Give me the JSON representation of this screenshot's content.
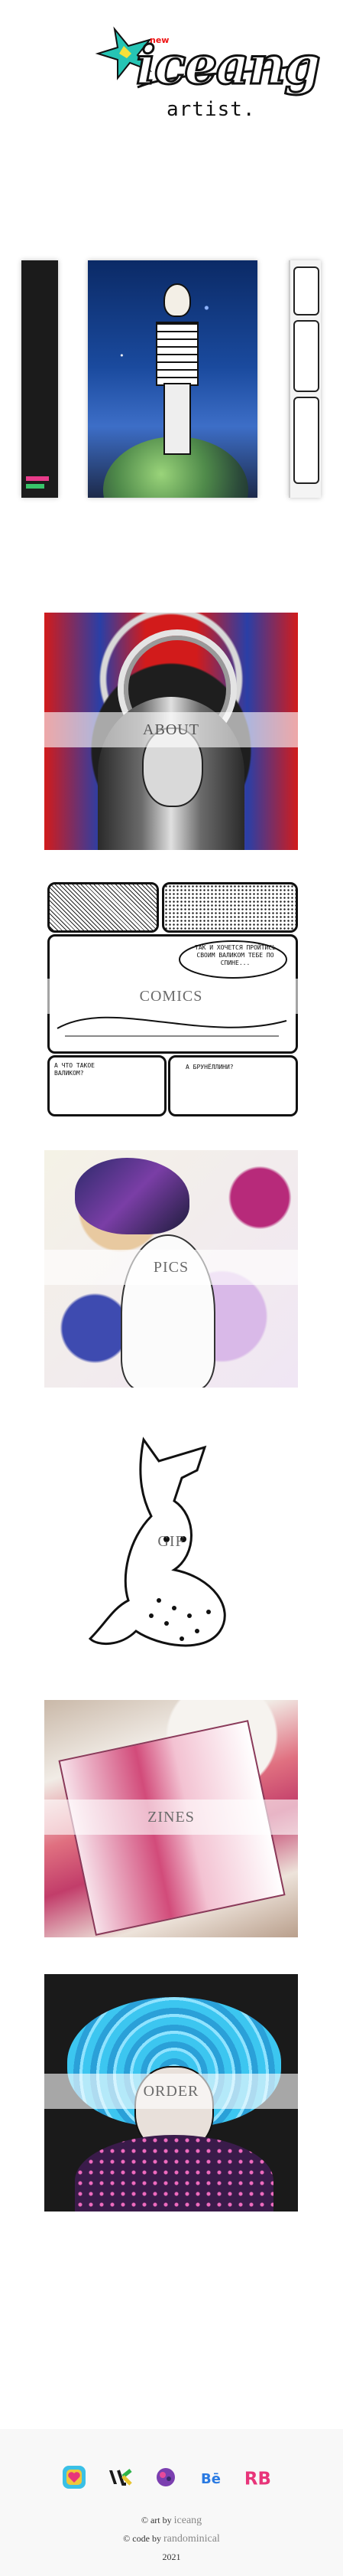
{
  "logo": {
    "word": "iceang",
    "subtitle": "artist.",
    "badge": "new"
  },
  "menu": [
    {
      "label": "ABOUT"
    },
    {
      "label": "COMICS"
    },
    {
      "label": "PICS"
    },
    {
      "label": "GIF"
    },
    {
      "label": "ZINES"
    },
    {
      "label": "ORDER"
    }
  ],
  "comics": {
    "bubble1": "ТАК И ХОЧЕТСЯ ПРОЙТИСЬ СВОИМ ВАЛИКОМ ТЕБЕ ПО СПИНЕ...",
    "bubble2": "А ЧТО ТАКОЕ ВАЛИКОМ?",
    "bubble3": "А БРУНЁЛЛИНИ?"
  },
  "footer": {
    "social": [
      "instagram-icon",
      "vk-icon",
      "patreon-icon",
      "behance-icon",
      "redbubble-icon"
    ],
    "art_prefix": "© art by",
    "art_name": "iceang",
    "code_prefix": "© code by",
    "code_name": "randominical",
    "year": "2021"
  }
}
